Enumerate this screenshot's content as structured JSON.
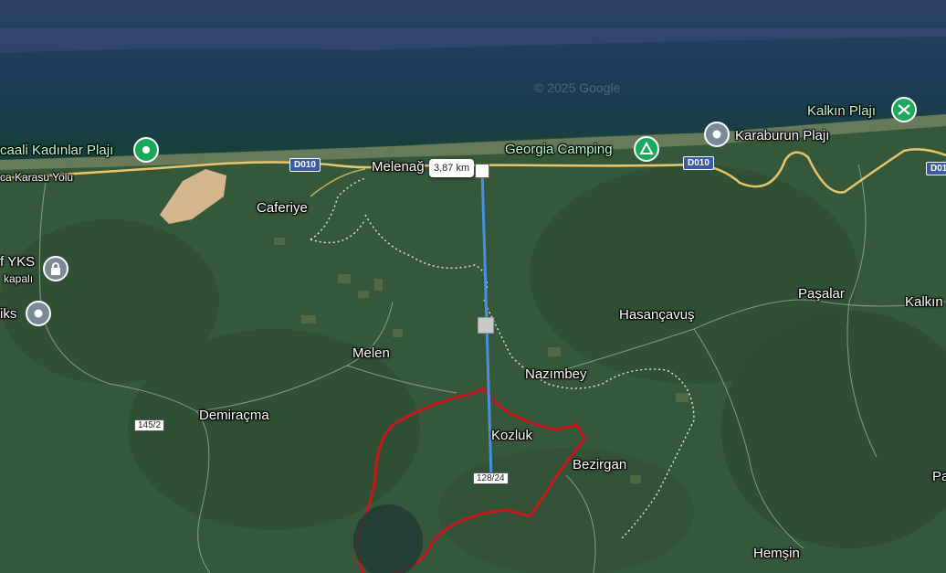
{
  "map": {
    "watermark": "© 2025 Google",
    "places": {
      "caferiye": "Caferiye",
      "melen": "Melen",
      "demiracma": "Demiraçma",
      "nazimbey": "Nazımbey",
      "hasancavus": "Hasançavuş",
      "pasalar": "Paşalar",
      "kalkin": "Kalkın",
      "kozluk": "Kozluk",
      "bezirgan": "Bezirgan",
      "hemsin": "Hemşin",
      "melenagzi": "Melenağ",
      "pa_edge": "Pa"
    },
    "pois": {
      "kadinlar_plaji": "caali Kadınlar Plajı",
      "georgia_camping": "Georgia Camping",
      "karaburun_plaji": "Karaburun Plajı",
      "kalkin_plaji": "Kalkın Plajı",
      "yks_name": "f YKS",
      "yks_status": "kapalı",
      "iks": "iks"
    },
    "roads": {
      "karasu_yolu": "ca Karasu Yolu",
      "d010_a": "D010",
      "d010_b": "D010",
      "d010_c": "D01",
      "r145": "145/2",
      "r128": "128/24"
    },
    "measure": {
      "distance": "3,87 km"
    },
    "colors": {
      "sea": "#1f3a63",
      "coast": "#1c4a34",
      "land": "#3a5e39",
      "road": "#e9c46a",
      "measure_line": "#4a90e2",
      "boundary": "#c8161d",
      "poi_green": "#1aa85a",
      "poi_gray": "#7a8a96"
    }
  }
}
